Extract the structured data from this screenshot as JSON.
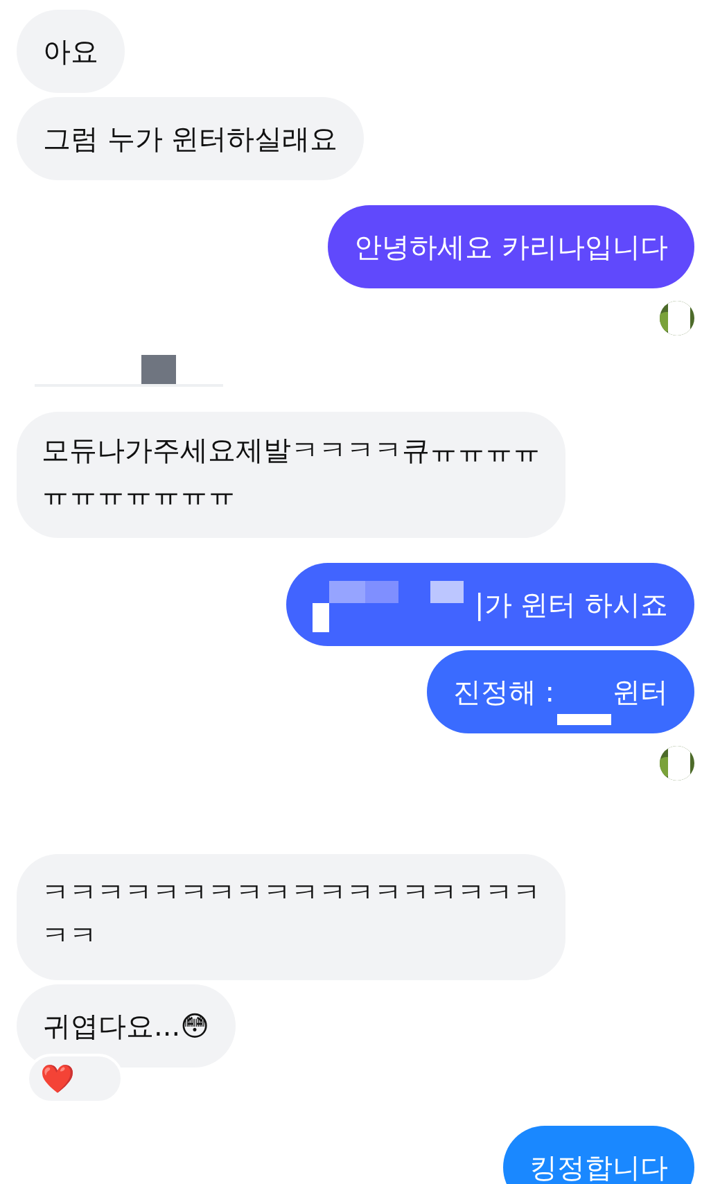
{
  "messages": [
    {
      "kind": "received",
      "lines": [
        "아요"
      ]
    },
    {
      "kind": "received",
      "lines": [
        "그럼 누가 윈터하실래요"
      ]
    },
    {
      "kind": "sent",
      "color": "#6049fc",
      "lines": [
        "안녕하세요 카리나입니다"
      ]
    },
    {
      "kind": "seen"
    },
    {
      "kind": "redaction"
    },
    {
      "kind": "received",
      "lines": [
        "모듀나가주세요제발ㅋㅋㅋㅋ큐ㅠㅠㅠㅠ",
        "ㅠㅠㅠㅠㅠㅠㅠ"
      ]
    },
    {
      "kind": "sent",
      "color": "#4164ff",
      "redacted": true,
      "lines": [
        "|가 윈터 하시죠"
      ]
    },
    {
      "kind": "sent",
      "color": "#3a6bff",
      "parts": [
        "진정해 :",
        "윈터"
      ]
    },
    {
      "kind": "seen"
    },
    {
      "kind": "received",
      "lines": [
        "ㅋㅋㅋㅋㅋㅋㅋㅋㅋㅋㅋㅋㅋㅋㅋㅋㅋㅋ",
        "ㅋㅋ"
      ]
    },
    {
      "kind": "received",
      "lines": [
        "귀엽다요...😳"
      ],
      "reaction": "❤️"
    },
    {
      "kind": "sent",
      "color": "#1a88ff",
      "lines": [
        "킹정합니다"
      ]
    }
  ]
}
